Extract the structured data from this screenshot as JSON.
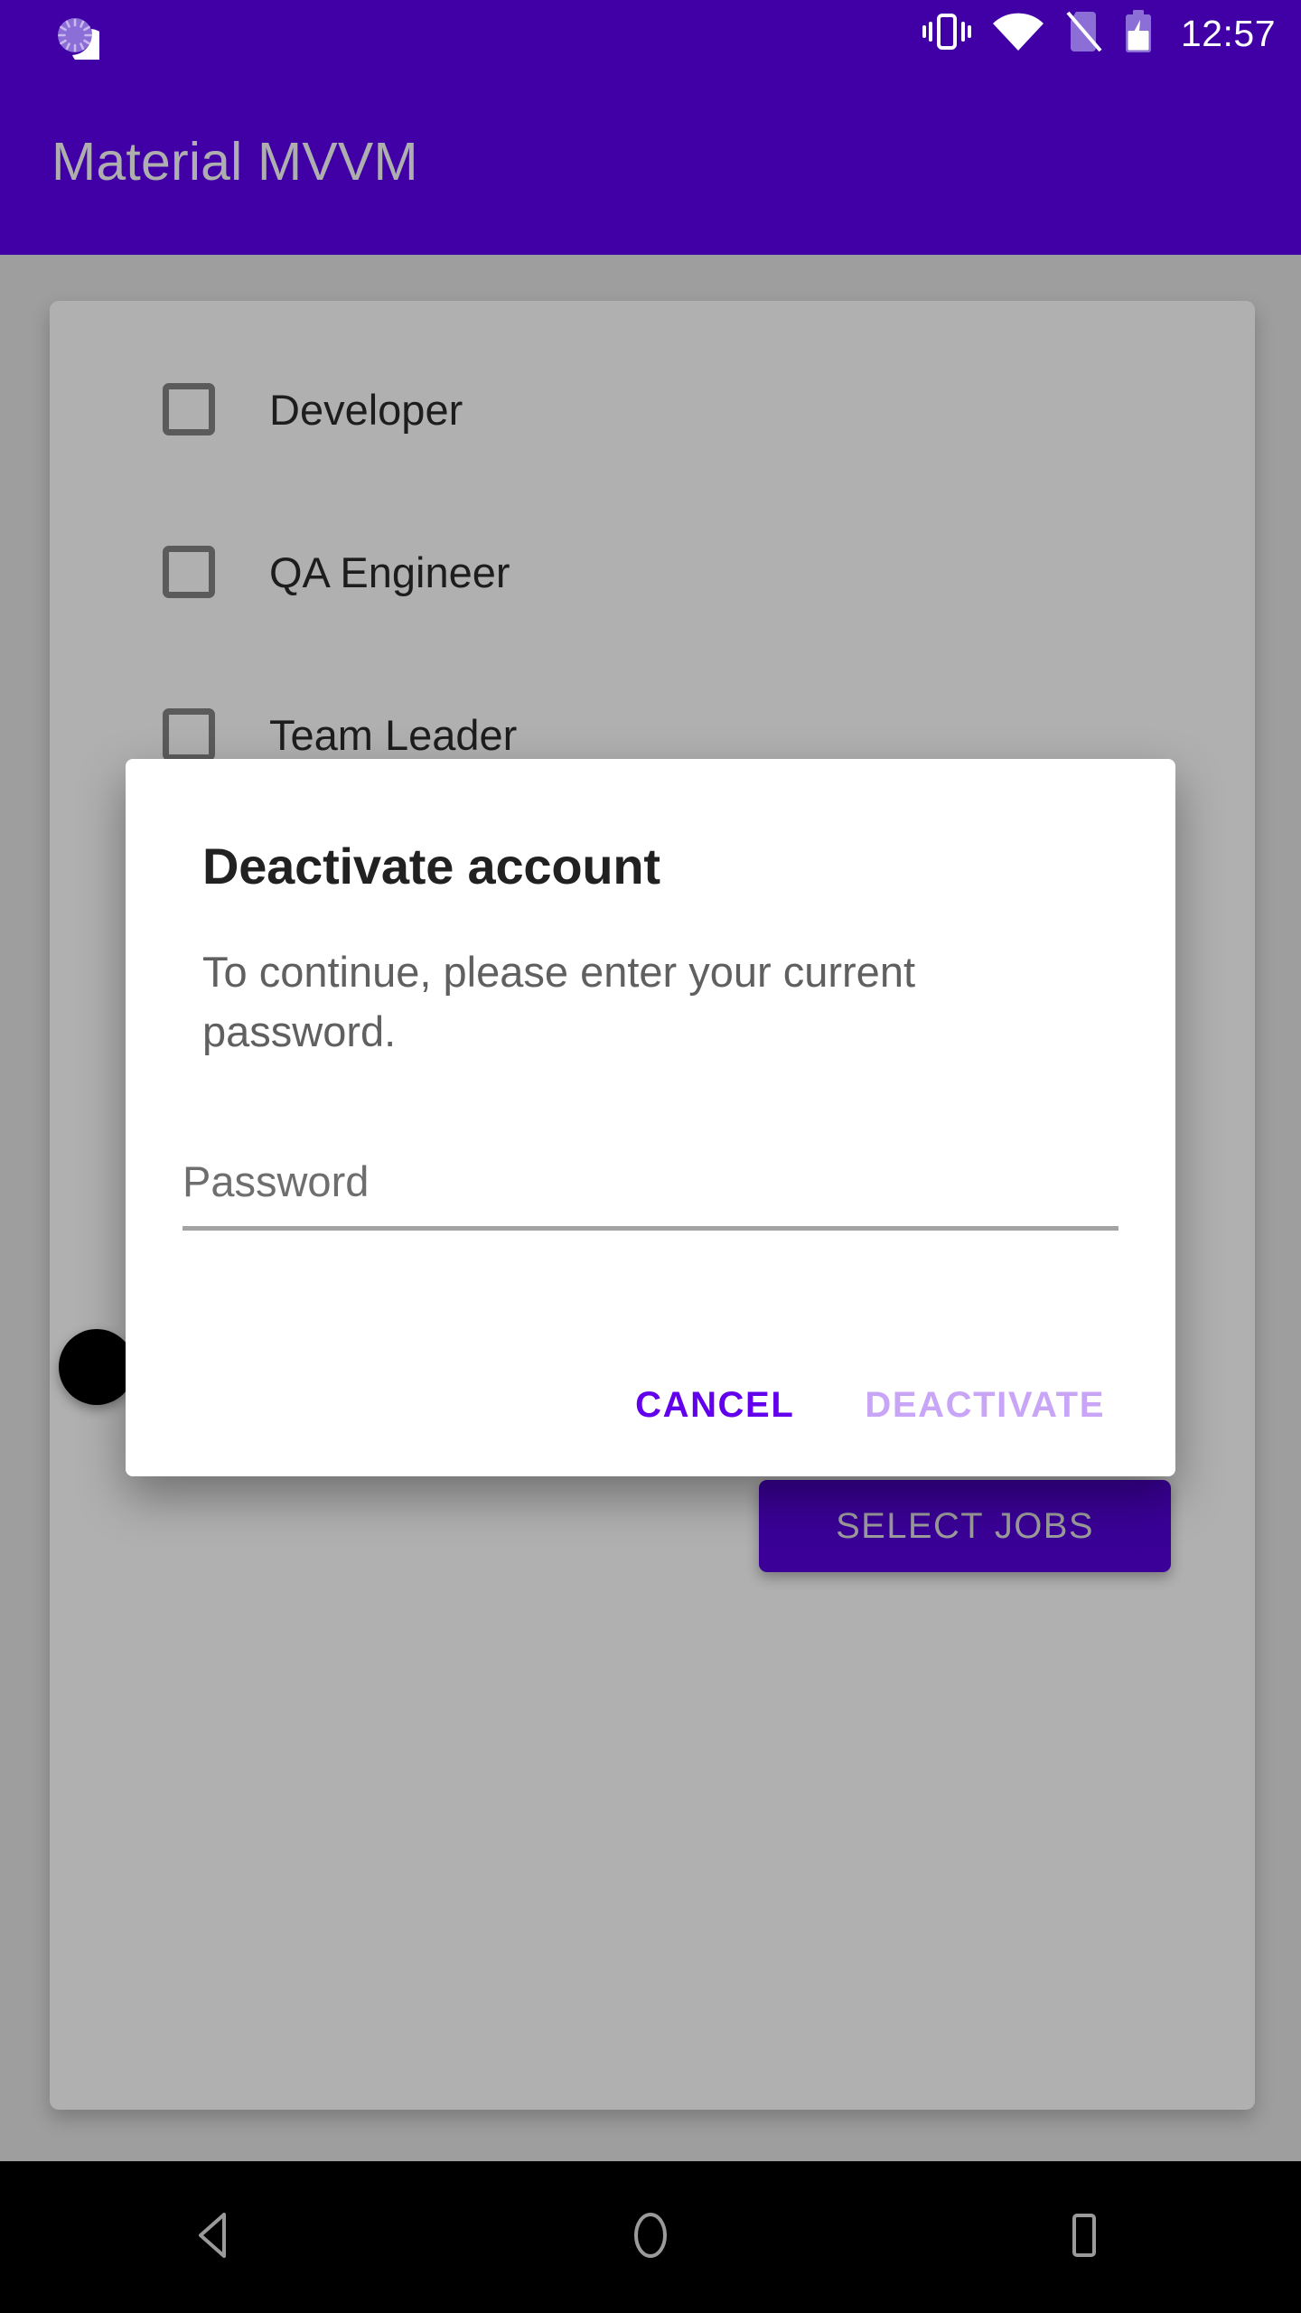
{
  "status_bar": {
    "time": "12:57",
    "icons": [
      {
        "name": "notification-spinner-icon"
      },
      {
        "name": "vibrate-icon"
      },
      {
        "name": "wifi-icon"
      },
      {
        "name": "no-sim-icon"
      },
      {
        "name": "battery-charging-icon"
      }
    ]
  },
  "app_bar": {
    "title": "Material MVVM"
  },
  "content": {
    "jobs": [
      {
        "label": "Developer",
        "checked": false
      },
      {
        "label": "QA Engineer",
        "checked": false
      },
      {
        "label": "Team Leader",
        "checked": false
      }
    ],
    "select_jobs_label": "SELECT JOBS"
  },
  "dialog": {
    "title": "Deactivate account",
    "message": "To continue, please enter your current password.",
    "password_placeholder": "Password",
    "password_value": "",
    "cancel_label": "CANCEL",
    "confirm_label": "DEACTIVATE"
  },
  "nav_bar": {
    "back_label": "back-icon",
    "home_label": "home-icon",
    "recents_label": "recents-icon"
  },
  "colors": {
    "app_bar_purple": "#4000A6",
    "brand_purple": "#6200EE",
    "disabled_purple": "#C9A5F7",
    "scrim_gray": "#9E9E9E",
    "card_gray": "#B0B0B0",
    "dialog_white": "#FFFFFF",
    "nav_black": "#000000"
  }
}
